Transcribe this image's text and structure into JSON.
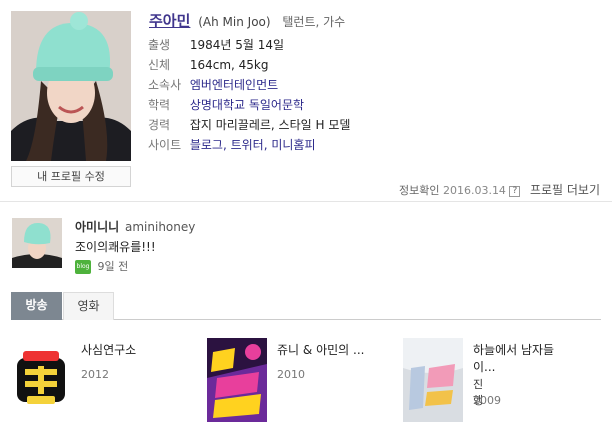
{
  "profile": {
    "name": "주아민",
    "name_en": "(Ah Min Joo)",
    "roles": "탤런트, 가수",
    "edit_button": "내 프로필 수정",
    "info": [
      {
        "label": "출생",
        "value": "1984년 5월 14일"
      },
      {
        "label": "신체",
        "value": "164cm, 45kg"
      },
      {
        "label": "소속사",
        "value": "엠버엔터테인먼트"
      },
      {
        "label": "학력",
        "value": "상명대학교 독일어문학"
      },
      {
        "label": "경력",
        "value": "잡지 마리끌레르, 스타일 H 모델"
      },
      {
        "label": "사이트",
        "value": "블로그, 트위터, 미니홈피"
      }
    ],
    "verify_label": "정보확인",
    "verify_date": "2016.03.14",
    "verify_icon": "?",
    "more_link": "프로필 더보기"
  },
  "sns": {
    "name": "아미니니",
    "id": "aminihoney",
    "post": "조이의쾌유를!!!",
    "badge": "blog",
    "time": "9일 전"
  },
  "tabs": [
    {
      "label": "방송",
      "active": true
    },
    {
      "label": "영화",
      "active": false
    }
  ],
  "shows": [
    {
      "title": "사심연구소",
      "role": "",
      "year": "2012"
    },
    {
      "title": "쥬니 & 아민의 ...",
      "role": "",
      "year": "2010"
    },
    {
      "title_line1": "하늘에서 남자들",
      "title_line2": "이...",
      "role": "진행",
      "year": "2009"
    }
  ],
  "colors": {
    "name_link": "#40368d",
    "tab_active": "#7d8791",
    "blog_badge": "#4eb23c"
  }
}
